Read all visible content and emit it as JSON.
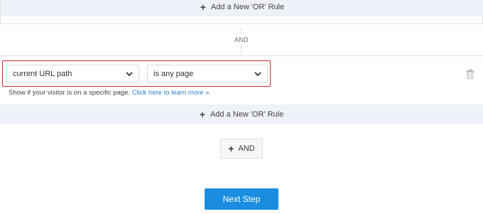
{
  "previous_rule": {
    "add_or_rule_label": "Add a New 'OR' Rule"
  },
  "connector": {
    "and_label": "AND"
  },
  "rule": {
    "condition_select": {
      "value": "current URL path"
    },
    "operator_select": {
      "value": "is any page"
    },
    "help_text": "Show if your visitor is on a specific page.",
    "help_link": "Click here to learn more »",
    "add_or_rule_label": "Add a New 'OR' Rule",
    "delete_icon": "trash-icon"
  },
  "add_and_button": {
    "label": "AND",
    "icon": "plus-icon"
  },
  "next_step_button": {
    "label": "Next Step"
  },
  "colors": {
    "accent": "#1a8de0",
    "highlight_border": "#d0252f",
    "link": "#2b7fd4",
    "or_bar_bg": "#eef1f7"
  }
}
